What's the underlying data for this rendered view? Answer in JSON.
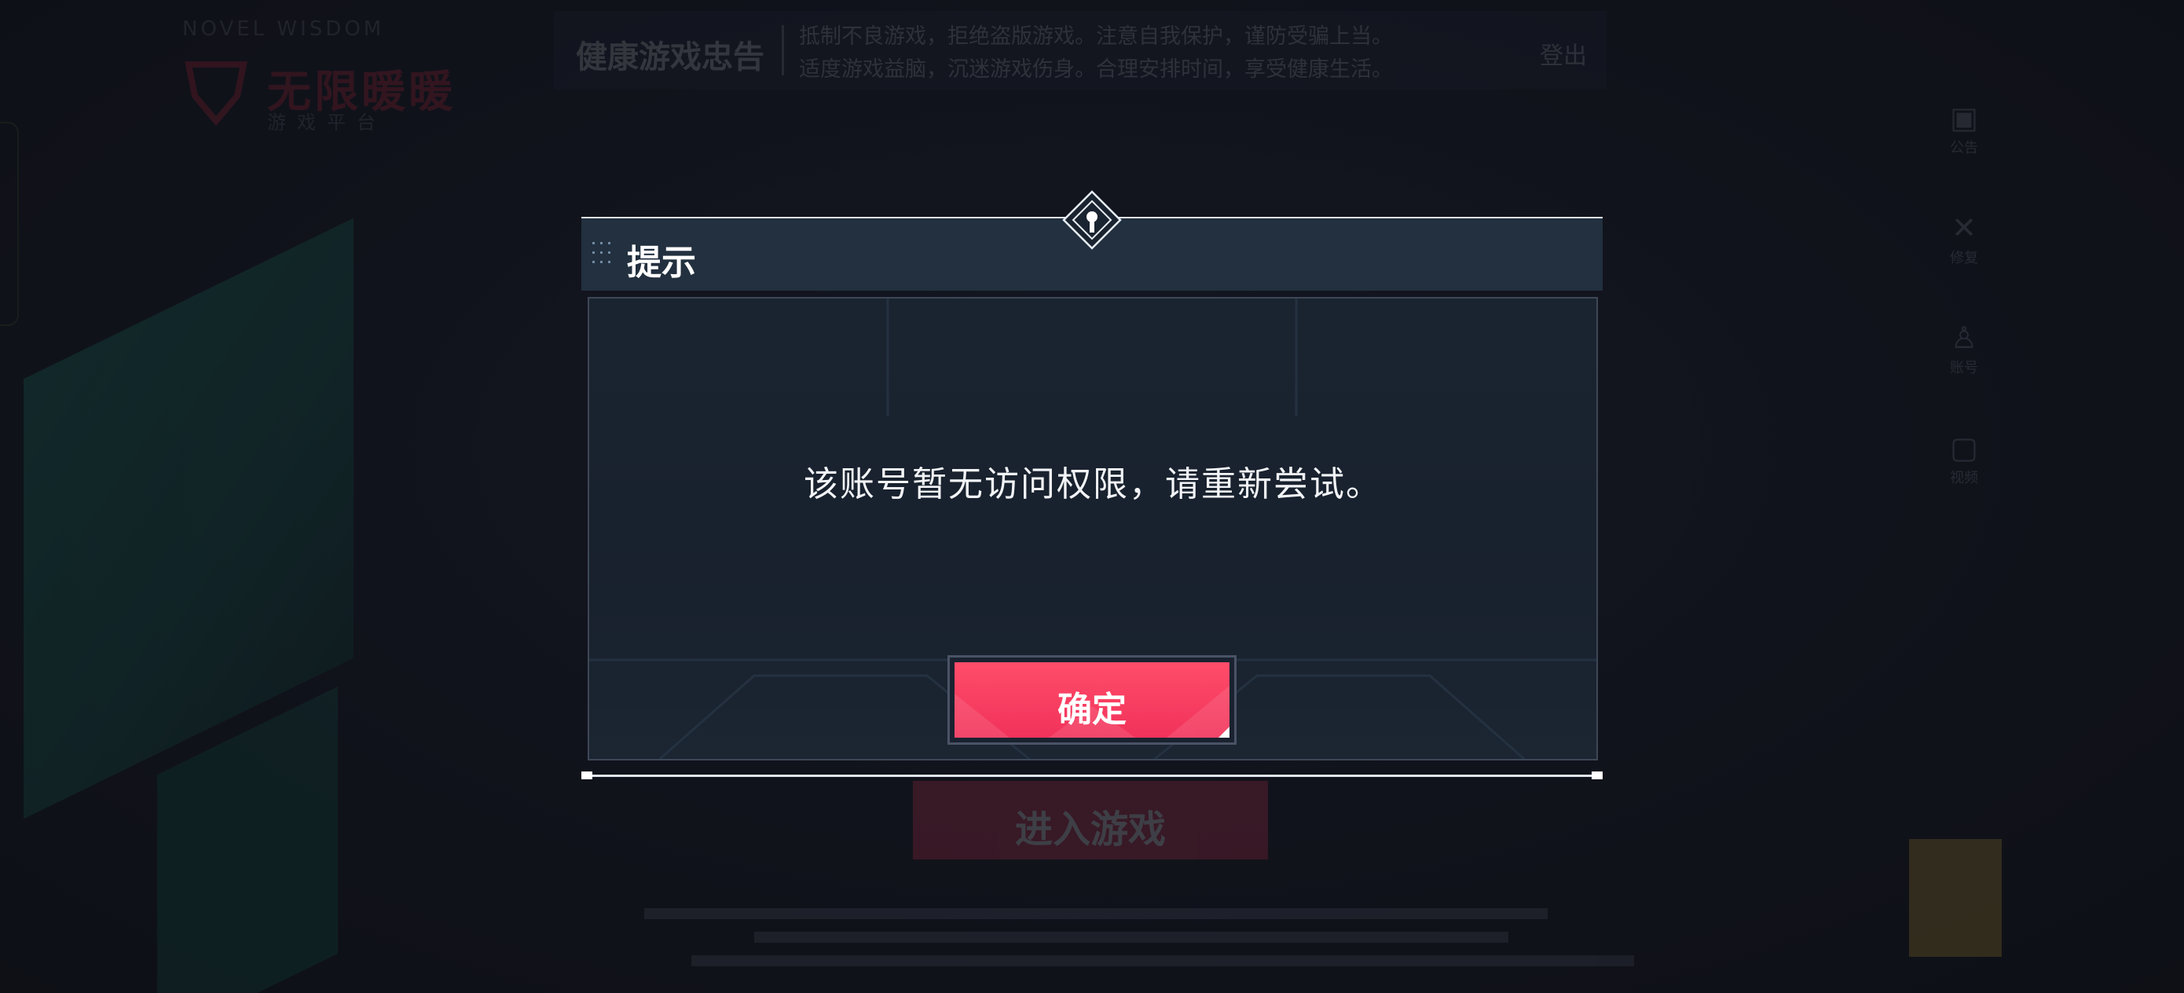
{
  "background": {
    "logo": {
      "top_text": "NOVEL WISDOM",
      "name": "无限暖暖",
      "subtitle": "游戏平台"
    },
    "notice": {
      "title": "健康游戏忠告",
      "line1": "抵制不良游戏，拒绝盗版游戏。注意自我保护，谨防受骗上当。",
      "line2": "适度游戏益脑，沉迷游戏伤身。合理安排时间，享受健康生活。",
      "more_label": "登出"
    },
    "side_buttons": [
      {
        "icon": "notice-icon",
        "glyph": "▣",
        "label": "公告"
      },
      {
        "icon": "tools-icon",
        "glyph": "✕",
        "label": "修复"
      },
      {
        "icon": "user-icon",
        "glyph": "♙",
        "label": "账号"
      },
      {
        "icon": "media-icon",
        "glyph": "▢",
        "label": "视频"
      }
    ],
    "enter_game_label": "进入游戏"
  },
  "dialog": {
    "title": "提示",
    "message": "该账号暂无访问权限，请重新尝试。",
    "confirm_label": "确定"
  },
  "colors": {
    "accent": "#f1325a",
    "panel": "#22303f",
    "text": "#ffffff"
  }
}
